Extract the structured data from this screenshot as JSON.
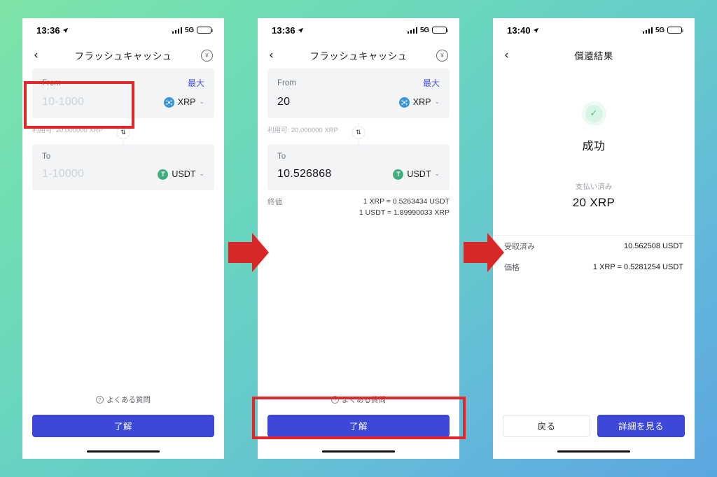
{
  "background": {
    "from": "#7fe3a8",
    "mid": "#66c9cc",
    "to": "#5aa7e0"
  },
  "accent": {
    "primary_blue": "#3b48d8",
    "annotation_red": "#e02828",
    "success_green": "#4fbf83",
    "link_blue": "#4458e0"
  },
  "arrows": [
    {
      "name": "flow-arrow-1",
      "color": "#d62828"
    },
    {
      "name": "flow-arrow-2",
      "color": "#d62828"
    }
  ],
  "screens": [
    {
      "id": "swap-empty",
      "status": {
        "time": "13:36",
        "network": "5G",
        "location_icon": "location-arrow-icon"
      },
      "nav": {
        "back": "‹",
        "title": "フラッシュキャッシュ",
        "right_icon": "yen-circle-icon"
      },
      "from": {
        "label": "From",
        "max": "最大",
        "value": "",
        "placeholder": "10-1000",
        "coin": "XRP",
        "coin_icon": "xrp-coin-icon",
        "chevron": "⌄"
      },
      "available": "利用可: 20.000000 XRP",
      "swap_icon": "swap-vertical-icon",
      "to": {
        "label": "To",
        "value": "",
        "placeholder": "1-10000",
        "coin": "USDT",
        "coin_icon": "usdt-coin-icon",
        "chevron": "⌄"
      },
      "rate": {
        "label": "",
        "lines": []
      },
      "faq": {
        "icon": "question-circle-icon",
        "label": "よくある質問"
      },
      "primary_button": "了解"
    },
    {
      "id": "swap-filled",
      "status": {
        "time": "13:36",
        "network": "5G",
        "location_icon": "location-arrow-icon"
      },
      "nav": {
        "back": "‹",
        "title": "フラッシュキャッシュ",
        "right_icon": "yen-circle-icon"
      },
      "from": {
        "label": "From",
        "max": "最大",
        "value": "20",
        "placeholder": "10-1000",
        "coin": "XRP",
        "coin_icon": "xrp-coin-icon",
        "chevron": "⌄"
      },
      "available": "利用可: 20.000000 XRP",
      "swap_icon": "swap-vertical-icon",
      "to": {
        "label": "To",
        "value": "10.526868",
        "placeholder": "1-10000",
        "coin": "USDT",
        "coin_icon": "usdt-coin-icon",
        "chevron": "⌄"
      },
      "rate": {
        "label": "終値",
        "lines": [
          "1 XRP = 0.5263434 USDT",
          "1 USDT = 1.89990033 XRP"
        ]
      },
      "faq": {
        "icon": "question-circle-icon",
        "label": "よくある質問"
      },
      "primary_button": "了解"
    },
    {
      "id": "result",
      "status": {
        "time": "13:40",
        "network": "5G",
        "location_icon": "location-arrow-icon"
      },
      "nav": {
        "back": "‹",
        "title": "償還結果",
        "right_icon": ""
      },
      "success_icon": "check-circle-icon",
      "status_text": "成功",
      "paid_label": "支払い済み",
      "paid_amount": "20 XRP",
      "details": [
        {
          "key": "受取済み",
          "value": "10.562508 USDT"
        },
        {
          "key": "価格",
          "value": "1 XRP = 0.5281254 USDT"
        }
      ],
      "secondary_button": "戻る",
      "primary_button": "詳細を見る"
    }
  ]
}
